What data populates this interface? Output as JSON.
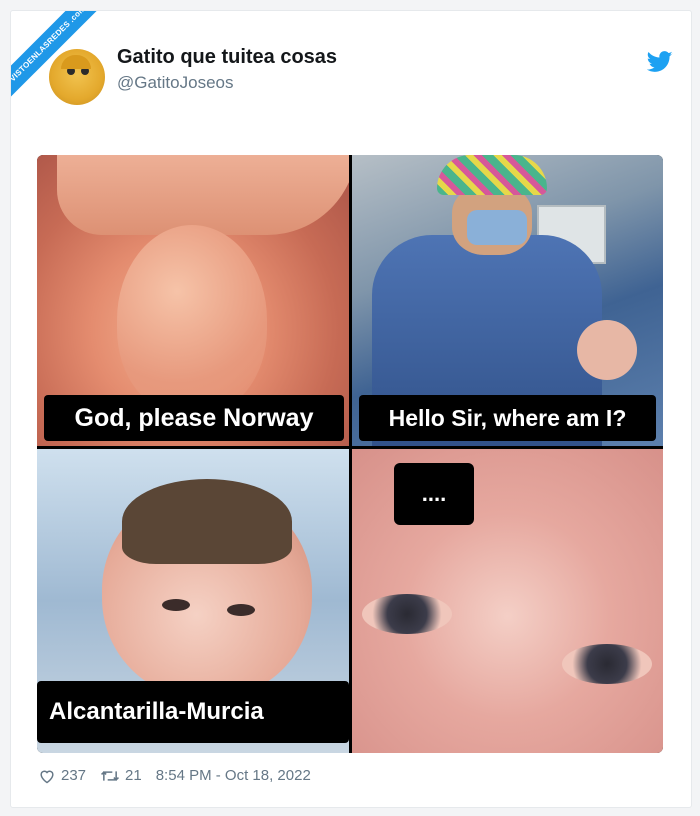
{
  "watermark": {
    "text": "VISTOENLASREDES .com"
  },
  "tweet": {
    "author_name": "Gatito que tuitea cosas",
    "author_handle": "@GatitoJoseos",
    "captions": {
      "panel1": "God, please Norway",
      "panel2": "Hello Sir, where am I?",
      "panel3": "Alcantarilla-Murcia",
      "panel4": "...."
    },
    "likes": "237",
    "retweets": "21",
    "timestamp": "8:54 PM - Oct 18, 2022"
  },
  "colors": {
    "twitter_blue": "#1da1f2",
    "text_primary": "#14171a",
    "text_secondary": "#657786"
  },
  "icons": {
    "brand": "twitter-bird-icon",
    "like": "heart-icon",
    "retweet": "retweet-icon"
  }
}
